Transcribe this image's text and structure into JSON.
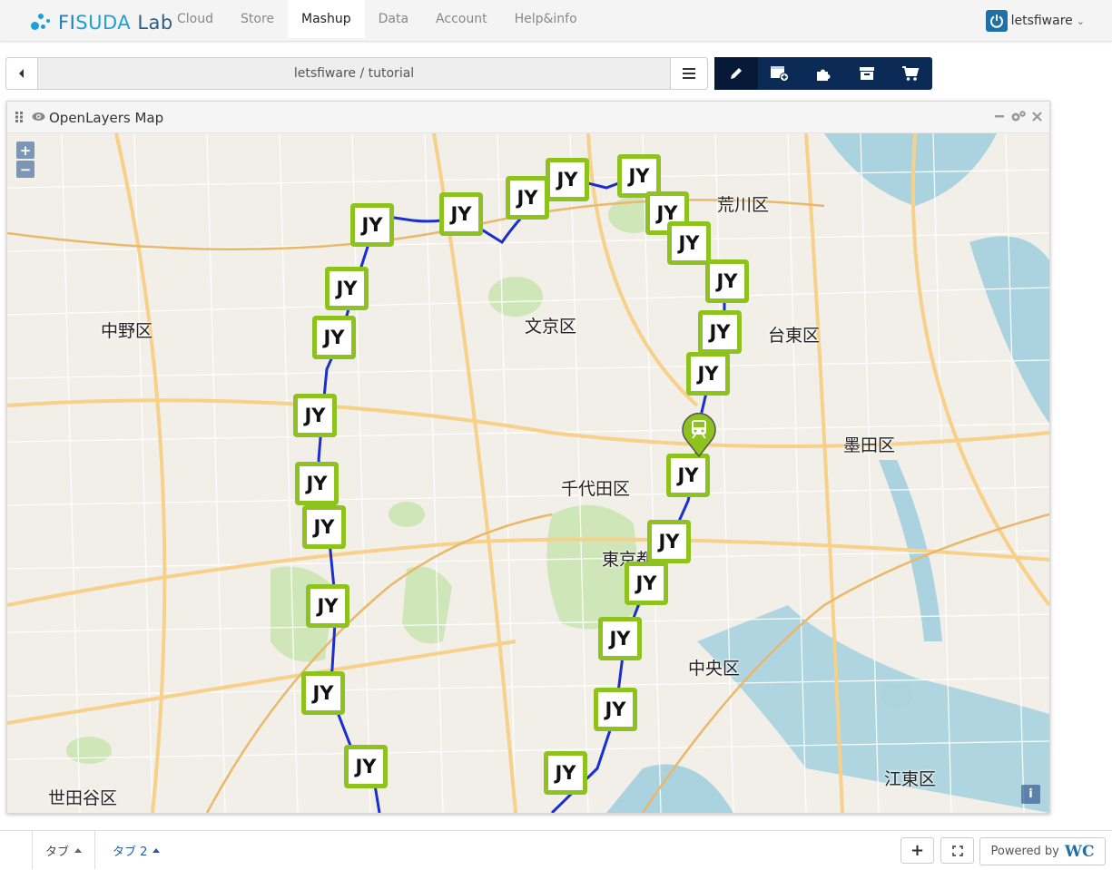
{
  "app": {
    "logo_text_fi": "FI",
    "logo_text_suda": "SUDA",
    "logo_text_lab": " Lab"
  },
  "nav": {
    "items": [
      {
        "label": "Cloud"
      },
      {
        "label": "Store"
      },
      {
        "label": "Mashup"
      },
      {
        "label": "Data"
      },
      {
        "label": "Account"
      },
      {
        "label": "Help&info"
      }
    ],
    "active": "Mashup"
  },
  "user": {
    "name": "letsfiware",
    "caret": "⌄"
  },
  "workspace": {
    "path": "letsfiware / tutorial"
  },
  "toolbar": {
    "buttons": [
      "edit-icon",
      "add-widget-icon",
      "wiring-icon",
      "inbox-icon",
      "cart-icon"
    ],
    "active": "edit-icon",
    "color": "#0b2a55"
  },
  "widget": {
    "title": "OpenLayers Map",
    "zoom_in": "+",
    "zoom_out": "−",
    "info": "i"
  },
  "map": {
    "wards": [
      "荒川区",
      "文京区",
      "中野区",
      "台東区",
      "墨田区",
      "千代田区",
      "東京都",
      "中央区",
      "江東区",
      "世田谷区"
    ],
    "station_label": "JY",
    "station_count": 26,
    "line_color": "#1a2fd0",
    "marker_color": "#8dc21f"
  },
  "tabs": [
    {
      "label": "タブ"
    },
    {
      "label": "タブ 2"
    }
  ],
  "footer": {
    "add": "+",
    "fullscreen": "⛶",
    "powered_by": "Powered by",
    "powered_logo": "WC"
  }
}
